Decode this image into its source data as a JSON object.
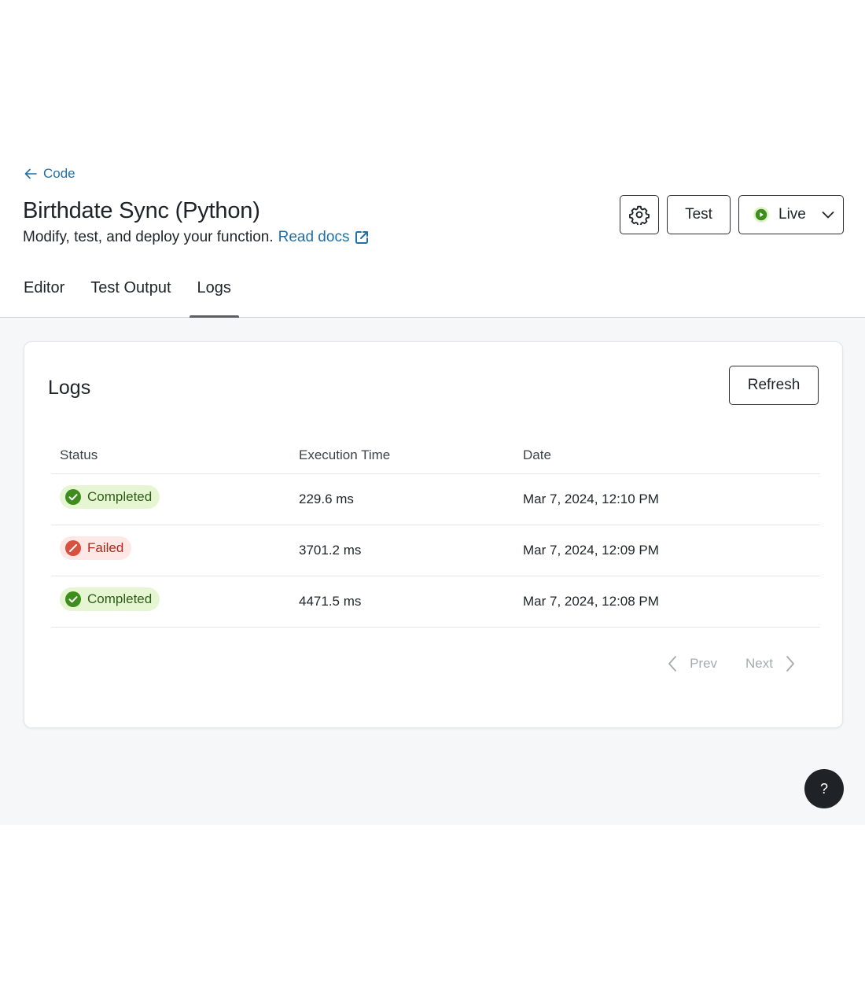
{
  "header": {
    "back_label": "Code",
    "title": "Birthdate Sync (Python)",
    "subtitle": "Modify, test, and deploy your function.",
    "docs_link": "Read docs",
    "test_label": "Test",
    "live_label": "Live"
  },
  "tabs": [
    {
      "label": "Editor",
      "active": false
    },
    {
      "label": "Test Output",
      "active": false
    },
    {
      "label": "Logs",
      "active": true
    }
  ],
  "logs": {
    "title": "Logs",
    "refresh_label": "Refresh",
    "columns": [
      "Status",
      "Execution Time",
      "Date"
    ],
    "rows": [
      {
        "status": "Completed",
        "status_type": "completed",
        "exec_time": "229.6 ms",
        "date": "Mar 7, 2024, 12:10 PM"
      },
      {
        "status": "Failed",
        "status_type": "failed",
        "exec_time": "3701.2 ms",
        "date": "Mar 7, 2024, 12:09 PM"
      },
      {
        "status": "Completed",
        "status_type": "completed",
        "exec_time": "4471.5 ms",
        "date": "Mar 7, 2024, 12:08 PM"
      }
    ],
    "pager": {
      "prev_label": "Prev",
      "next_label": "Next"
    }
  },
  "help_label": "?",
  "icons": {
    "back": "arrow-left-icon",
    "docs": "external-link-icon",
    "settings": "gear-icon",
    "live": "play-circle-icon",
    "dropdown": "chevron-down-icon",
    "completed": "check-circle-icon",
    "failed": "ban-icon",
    "prev": "chevron-left-icon",
    "next": "chevron-right-icon"
  },
  "colors": {
    "link": "#1f6fa8",
    "completed_bg": "#e6f6d3",
    "completed_fg": "#2e5d17",
    "completed_icon": "#3e8e1e",
    "failed_bg": "#fde8e6",
    "failed_fg": "#b0261c",
    "failed_icon": "#d9503f",
    "live_icon": "#3e8e1e"
  }
}
